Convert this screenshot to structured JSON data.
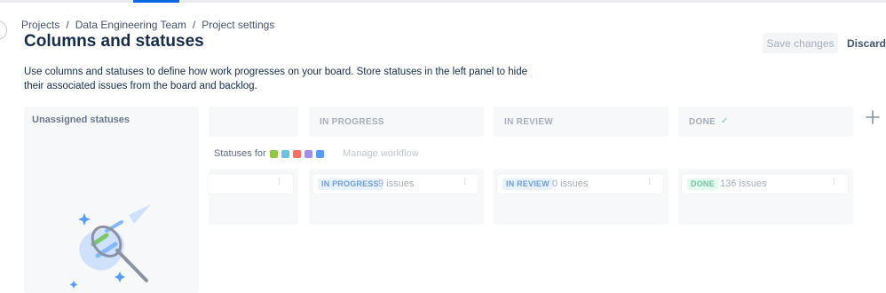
{
  "breadcrumb": {
    "items": [
      "Projects",
      "Data Engineering Team",
      "Project settings"
    ],
    "separator": "/"
  },
  "page": {
    "title": "Columns and statuses",
    "description": "Use columns and statuses to define how work progresses on your board. Store statuses in the left panel to hide their associated issues from the board and backlog."
  },
  "actions": {
    "save_label": "Save changes",
    "discard_label": "Discard"
  },
  "unassigned": {
    "title": "Unassigned statuses"
  },
  "statuses_for": {
    "label": "Statuses for",
    "issue_type_icons": [
      "story-icon",
      "task-icon",
      "bug-icon",
      "epic-icon",
      "subtask-icon"
    ],
    "manage_label": "Manage workflow"
  },
  "columns": [
    {
      "header": "",
      "lozenge": "",
      "count": ""
    },
    {
      "header": "IN PROGRESS",
      "lozenge": "IN PROGRESS",
      "count": "9 issues"
    },
    {
      "header": "IN REVIEW",
      "lozenge": "IN REVIEW",
      "count": "0 issues"
    },
    {
      "header": "DONE",
      "lozenge": "DONE",
      "count": "136 issues",
      "check": "✓"
    }
  ],
  "colors": {
    "accent": "#0c66e4",
    "lozenge_blue_bg": "#e9f2ff",
    "lozenge_blue_fg": "#6c9ee8",
    "lozenge_green_bg": "#e3fcef",
    "lozenge_green_fg": "#6ec59f"
  }
}
